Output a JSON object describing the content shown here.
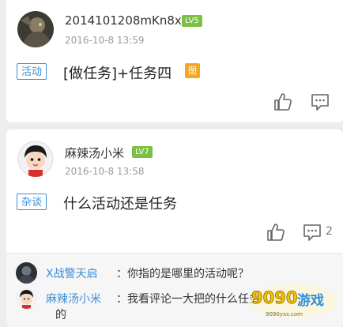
{
  "posts": [
    {
      "username": "2014101208mKn8x",
      "level": "LV5",
      "time": "2016-10-8 13:59",
      "tag": "活动",
      "text": "[做任务]+任务四",
      "image_badge": "图",
      "actions": {
        "like_icon": "thumbs-up-icon",
        "comment_icon": "comment-icon",
        "comment_count": ""
      }
    },
    {
      "username": "麻辣汤小米",
      "level": "LV7",
      "time": "2016-10-8 13:58",
      "tag": "杂谈",
      "text": "什么活动还是任务",
      "actions": {
        "like_icon": "thumbs-up-icon",
        "comment_icon": "comment-icon",
        "comment_count": "2"
      },
      "replies": [
        {
          "author": "X战警天启",
          "colon": "：",
          "text": "你指的是哪里的活动呢？"
        },
        {
          "author": "麻辣汤小米",
          "colon": "：",
          "text": "我看评论一大把的什么任务",
          "text_cont": "的"
        }
      ]
    }
  ],
  "watermark": {
    "brand": "9090",
    "sub": "游戏",
    "url": "9090yxs.com"
  },
  "colors": {
    "level_badge": "#7bc043",
    "tag_blue": "#3a8fd9",
    "image_badge": "#f5a623",
    "reply_bg": "#f6f6f6"
  }
}
